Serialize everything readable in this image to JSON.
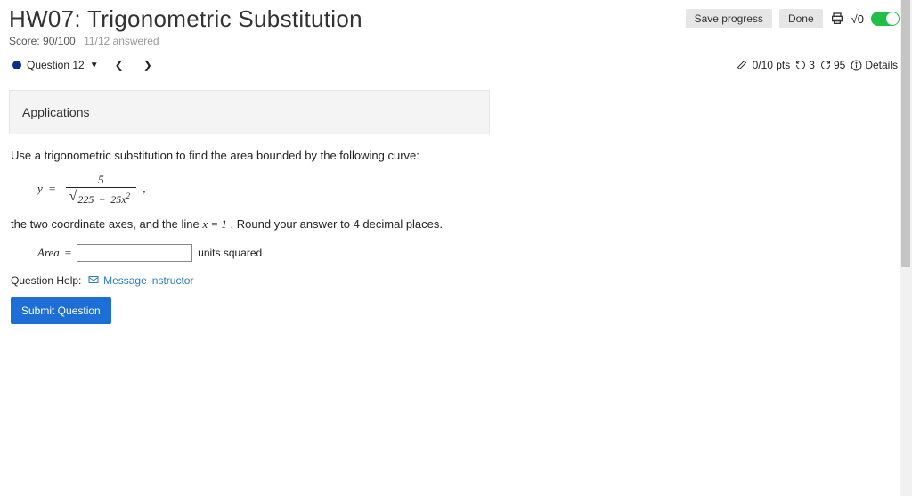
{
  "header": {
    "title": "HW07: Trigonometric Substitution",
    "save_label": "Save progress",
    "done_label": "Done",
    "mathmode_label": "√0"
  },
  "score": {
    "label": "Score: 90/100",
    "answered": "11/12 answered"
  },
  "nav": {
    "question_label": "Question 12",
    "pts": "0/10 pts",
    "attempts": "3",
    "countdown": "95",
    "details": "Details"
  },
  "banner": {
    "title": "Applications"
  },
  "question": {
    "prompt1": "Use a trigonometric substitution to find the area bounded by the following curve:",
    "lhs": "y",
    "eqsym": "=",
    "numerator": "5",
    "radicand_a": "225",
    "radicand_op": "−",
    "radicand_b": "25x",
    "radicand_exp": "2",
    "prompt2_a": "the two coordinate axes, and the line ",
    "prompt2_eq": "x = 1",
    "prompt2_b": ".  Round your answer to 4 decimal places.",
    "area_label": "Area",
    "area_eq": "=",
    "units_label": "units squared"
  },
  "help": {
    "label": "Question Help:",
    "link": "Message instructor"
  },
  "submit": {
    "label": "Submit Question"
  }
}
